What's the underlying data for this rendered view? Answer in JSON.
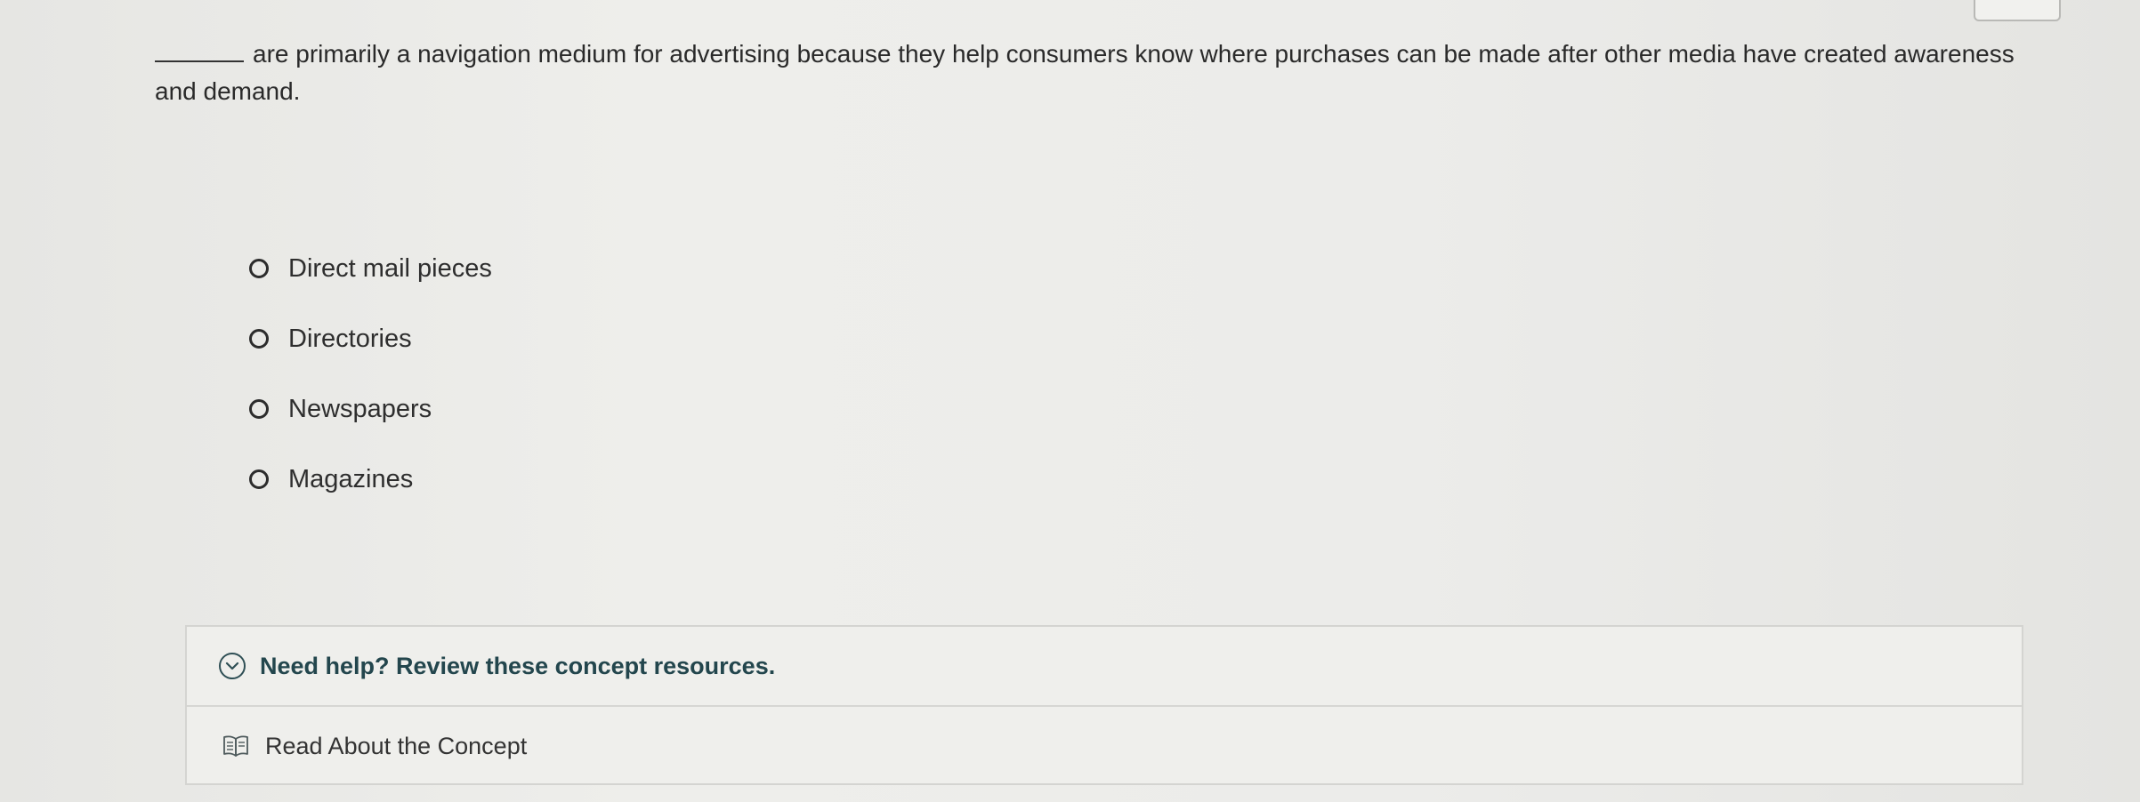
{
  "question": {
    "text": "are primarily a navigation medium for advertising because they help consumers know where purchases can be made after other media have created awareness and demand."
  },
  "options": [
    {
      "label": "Direct mail pieces"
    },
    {
      "label": "Directories"
    },
    {
      "label": "Newspapers"
    },
    {
      "label": "Magazines"
    }
  ],
  "help": {
    "title": "Need help? Review these concept resources.",
    "link_label": "Read About the Concept"
  },
  "icons": {
    "chevron": "chevron-down-icon",
    "book": "book-icon"
  },
  "colors": {
    "help_title": "#23464d",
    "radio_border": "#2c2c2c"
  }
}
